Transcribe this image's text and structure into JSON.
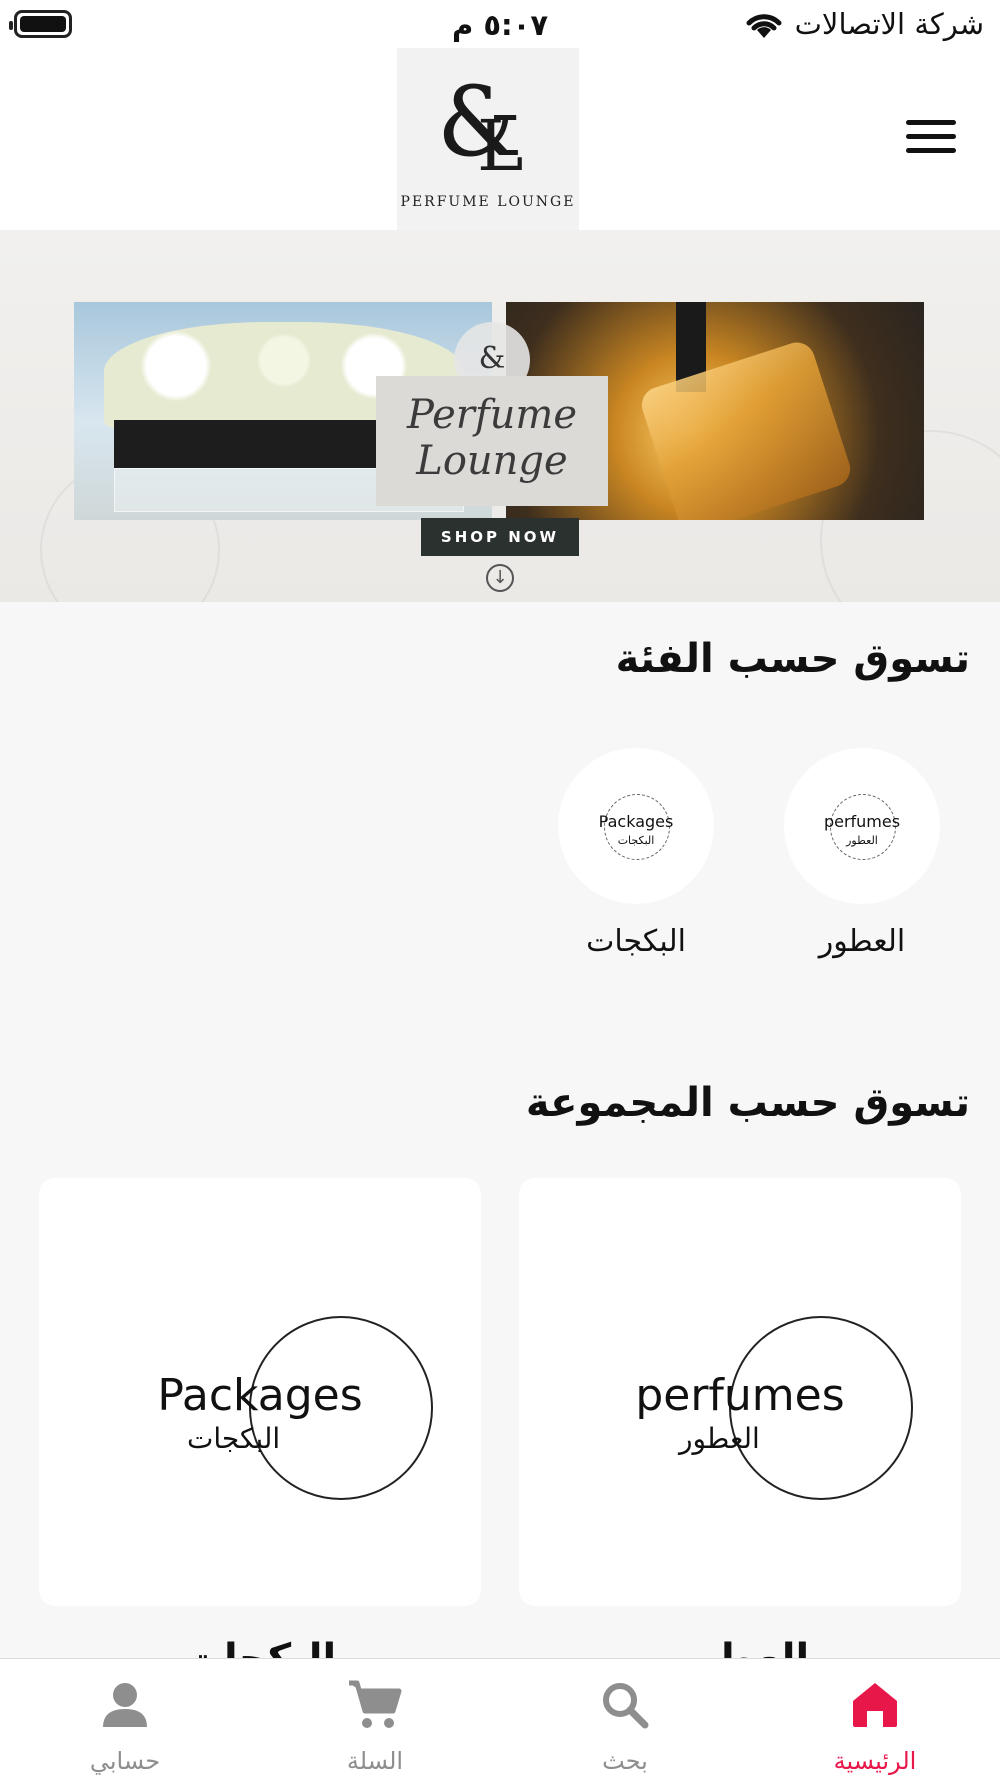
{
  "status_bar": {
    "carrier": "شركة الاتصالات",
    "time": "٥:٠٧ م"
  },
  "header": {
    "logo_monogram": "&RL",
    "logo_text": "PERFUME LOUNGE",
    "menu_icon": "hamburger-icon"
  },
  "banner": {
    "badge_text": "&",
    "title_line1": "Perfume",
    "title_line2": "Lounge",
    "cta_label": "SHOP NOW",
    "scroll_icon": "arrow-down-circle-icon"
  },
  "categories": {
    "title": "تسوق حسب الفئة",
    "items": [
      {
        "en": "perfumes",
        "ar": "العطور",
        "label": "العطور"
      },
      {
        "en": "Packages",
        "ar": "البكجات",
        "label": "البكجات"
      }
    ]
  },
  "collections": {
    "title": "تسوق حسب المجموعة",
    "items": [
      {
        "en": "perfumes",
        "ar": "العطور",
        "label": "العطور"
      },
      {
        "en": "Packages",
        "ar": "البكجات",
        "label": "البكجات"
      }
    ]
  },
  "tab_bar": {
    "accent_color": "#e8174a",
    "inactive_color": "#8e8e8e",
    "tabs": [
      {
        "label": "الرئيسية",
        "icon": "home-icon",
        "active": true
      },
      {
        "label": "بحث",
        "icon": "search-icon",
        "active": false
      },
      {
        "label": "السلة",
        "icon": "cart-icon",
        "active": false
      },
      {
        "label": "حسابي",
        "icon": "account-icon",
        "active": false
      }
    ]
  }
}
